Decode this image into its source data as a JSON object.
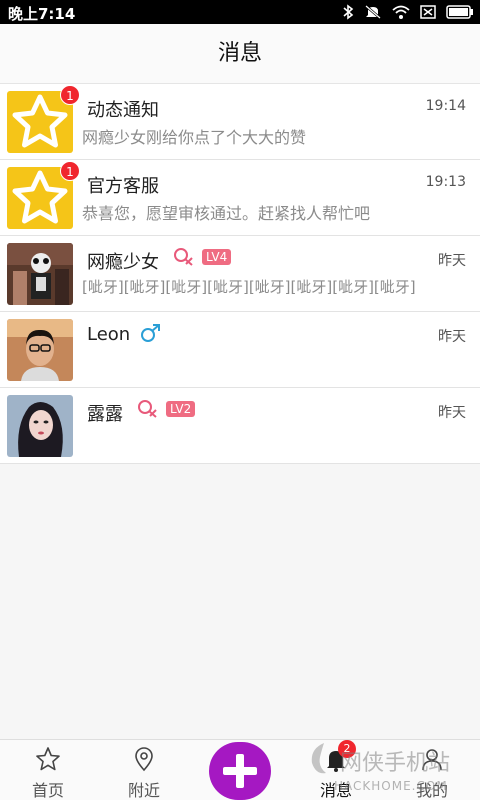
{
  "status_bar": {
    "time": "晚上7:14"
  },
  "header": {
    "title": "消息"
  },
  "messages": [
    {
      "name": "动态通知",
      "time": "19:14",
      "preview": "网瘾少女刚给你点了个大大的赞",
      "badge": "1",
      "avatar": "star-icon"
    },
    {
      "name": "官方客服",
      "time": "19:13",
      "preview": "恭喜您，愿望审核通过。赶紧找人帮忙吧",
      "badge": "1",
      "avatar": "star-icon"
    },
    {
      "name": "网瘾少女",
      "time": "昨天",
      "preview": "[呲牙][呲牙][呲牙][呲牙][呲牙][呲牙][呲牙][呲牙]",
      "level": "LV4",
      "gender": "female"
    },
    {
      "name": "Leon",
      "time": "昨天",
      "preview": "",
      "gender": "male"
    },
    {
      "name": "露露",
      "time": "昨天",
      "preview": "",
      "level": "LV2",
      "gender": "female"
    }
  ],
  "tabbar": {
    "home": "首页",
    "nearby": "附近",
    "messages": "消息",
    "messages_badge": "2",
    "mine": "我的"
  },
  "watermark": {
    "text": "网侠手机站",
    "url": "HACKHOME.COM"
  },
  "colors": {
    "accent": "#a518c2",
    "badge": "#f0262e",
    "level": "#ef6c82",
    "male": "#2a9fd6",
    "female": "#e8597a",
    "star_bg": "#f5c518"
  }
}
